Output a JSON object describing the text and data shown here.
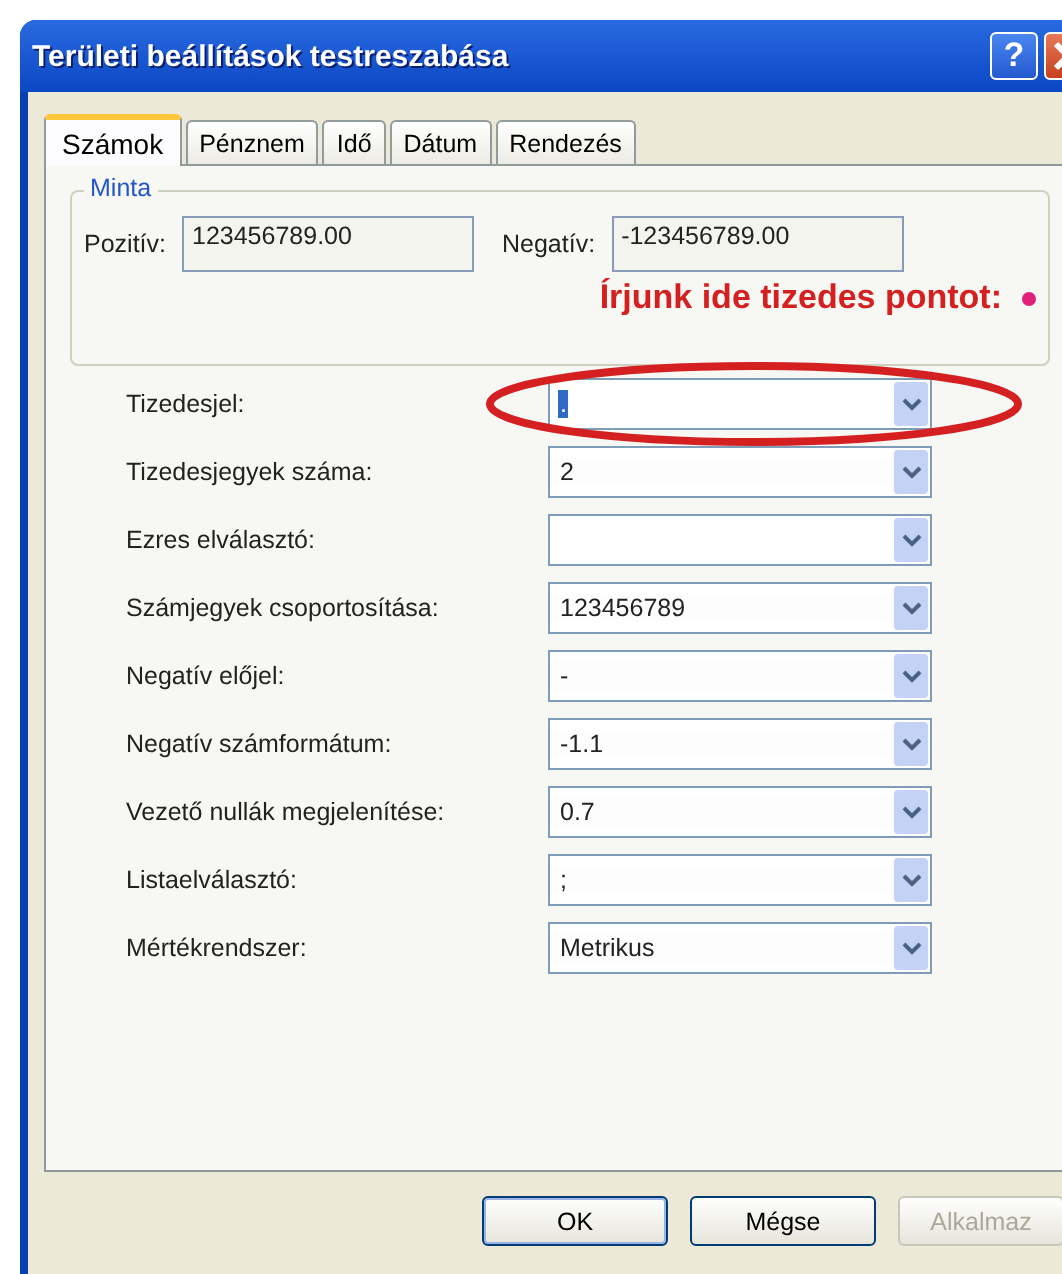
{
  "window": {
    "title": "Területi beállítások testreszabása",
    "help_button": "?"
  },
  "tabs": [
    {
      "label": "Számok",
      "selected": true
    },
    {
      "label": "Pénznem",
      "selected": false
    },
    {
      "label": "Idő",
      "selected": false
    },
    {
      "label": "Dátum",
      "selected": false
    },
    {
      "label": "Rendezés",
      "selected": false
    }
  ],
  "sample": {
    "title": "Minta",
    "positive_label": "Pozitív:",
    "positive_value": "123456789.00",
    "negative_label": "Negatív:",
    "negative_value": "-123456789.00"
  },
  "annotation": {
    "text": "Írjunk ide tizedes pontot:"
  },
  "settings": [
    {
      "label": "Tizedesjel:",
      "value": ".",
      "text_selected": true,
      "circled": true
    },
    {
      "label": "Tizedesjegyek száma:",
      "value": "2",
      "text_selected": false,
      "circled": false
    },
    {
      "label": "Ezres elválasztó:",
      "circled": false
    },
    {
      "label": "Számjegyek csoportosítása:",
      "value": "123456789",
      "text_selected": false,
      "circled": false
    },
    {
      "label": "Negatív előjel:",
      "value": "-",
      "text_selected": false,
      "circled": false
    },
    {
      "label": "Negatív számformátum:",
      "value": "-1.1",
      "text_selected": false,
      "circled": false
    },
    {
      "label": "Vezető nullák megjelenítése:",
      "value": "0.7",
      "text_selected": false,
      "circled": false
    },
    {
      "label": "Listaelválasztó:",
      "value": ";",
      "text_selected": false,
      "circled": false
    },
    {
      "label": "Mértékrendszer:",
      "value": "Metrikus",
      "text_selected": false,
      "circled": false
    }
  ],
  "buttons": [
    {
      "label": "OK",
      "disabled": false,
      "default": true
    },
    {
      "label": "Mégse",
      "disabled": false,
      "default": false
    },
    {
      "label": "Alkalmaz",
      "disabled": true,
      "default": false
    }
  ]
}
